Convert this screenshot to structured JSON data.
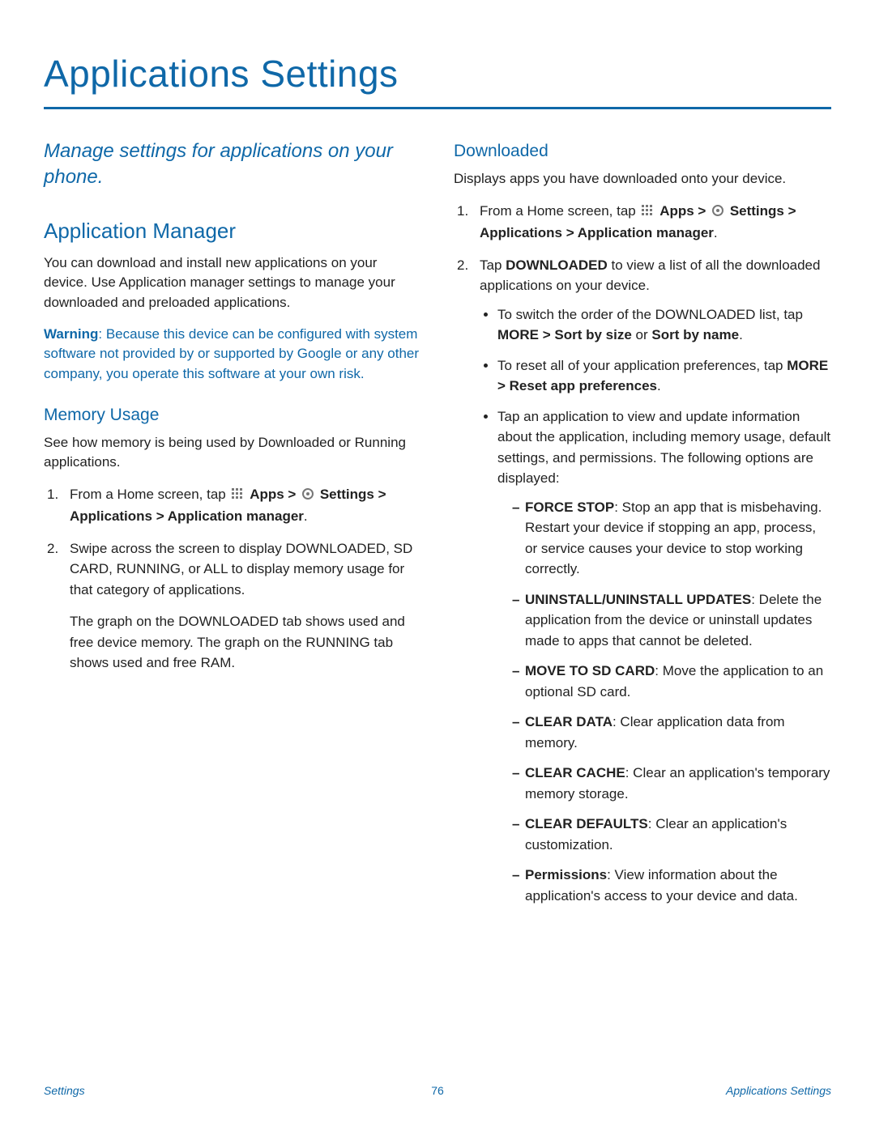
{
  "title": "Applications Settings",
  "intro": "Manage settings for applications on your phone.",
  "left": {
    "h2": "Application Manager",
    "p1": "You can download and install new applications on your device. Use Application manager settings to manage your downloaded and preloaded applications.",
    "warn_label": "Warning",
    "warn_body": ": Because this device can be configured with system software not provided by or supported by Google or any other company, you operate this software at your own risk.",
    "h3_memory": "Memory Usage",
    "memory_intro": "See how memory is being used by Downloaded or Running applications.",
    "step1_pre": "From a Home screen, tap ",
    "apps_label": "Apps",
    "gt": " > ",
    "settings_label": "Settings",
    "applications_label": "Applications",
    "appmanager_label": "Application manager",
    "period": ".",
    "step2_a": "Swipe across the screen to display DOWNLOADED, SD CARD, RUNNING, or ALL to display memory usage for that category of applications.",
    "step2_b": "The graph on the DOWNLOADED tab shows used and free device memory. The graph on the RUNNING tab shows used and free RAM."
  },
  "right": {
    "h3_downloaded": "Downloaded",
    "dl_intro": "Displays apps you have downloaded onto your device.",
    "step1_pre": "From a Home screen, tap ",
    "step2_pre": "Tap ",
    "downloaded_bold": "DOWNLOADED",
    "step2_post": " to view a list of all the downloaded applications on your device.",
    "bullet_switch_a": "To switch the order of the DOWNLOADED list, tap ",
    "more_sort": "MORE > Sort by size",
    "or_text": " or ",
    "sort_name": "Sort by name",
    "bullet_reset_a": "To reset all of your application preferences, tap ",
    "more_reset": "MORE > Reset app preferences",
    "bullet_tap_app": "Tap an application to view and update information about the application, including memory usage, default settings, and permissions. The following options are displayed:",
    "force_stop_label": "FORCE STOP",
    "force_stop_body": ": Stop an app that is misbehaving. Restart your device if stopping an app, process, or service causes your device to stop working correctly.",
    "uninstall_label": "UNINSTALL/UNINSTALL UPDATES",
    "uninstall_body": ": Delete the application from the device or uninstall updates made to apps that cannot be deleted.",
    "move_label": "MOVE TO SD CARD",
    "move_body": ": Move the application to an optional SD card.",
    "cleardata_label": "CLEAR DATA",
    "cleardata_body": ": Clear application data from memory.",
    "clearcache_label": "CLEAR CACHE",
    "clearcache_body": ": Clear an application's temporary memory storage.",
    "cleardef_label": "CLEAR DEFAULTS",
    "cleardef_body": ": Clear an application's customization.",
    "perm_label": "Permissions",
    "perm_body": ": View information about the application's access to your device and data."
  },
  "footer": {
    "left": "Settings",
    "page": "76",
    "right": "Applications Settings"
  }
}
